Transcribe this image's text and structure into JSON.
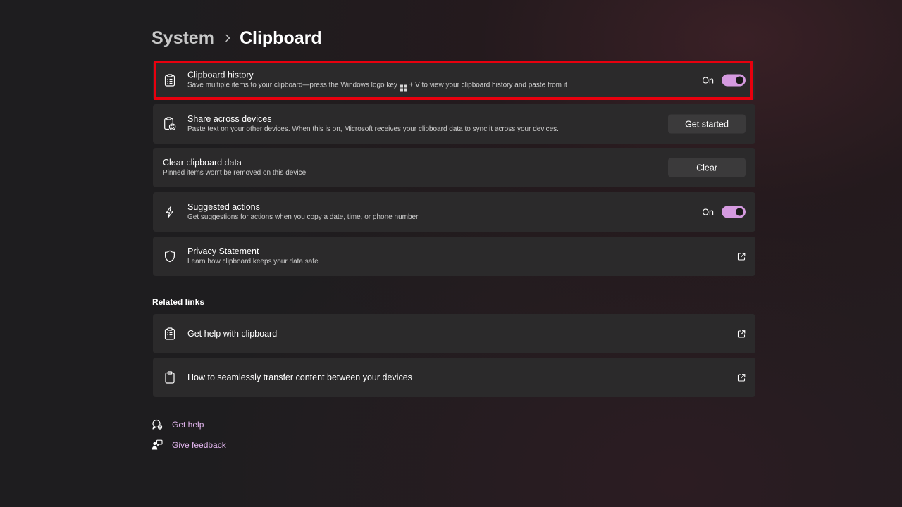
{
  "breadcrumb": {
    "parent": "System",
    "current": "Clipboard"
  },
  "settings": [
    {
      "icon": "clipboard-list-icon",
      "title": "Clipboard history",
      "description_before": "Save multiple items to your clipboard—press the Windows logo key",
      "description_after": "+ V to view your clipboard history and paste from it",
      "control": "toggle",
      "state_label": "On",
      "highlighted": true
    },
    {
      "icon": "clipboard-sync-icon",
      "title": "Share across devices",
      "description": "Paste text on your other devices. When this is on, Microsoft receives your clipboard data to sync it across your devices.",
      "control": "button",
      "button_label": "Get started"
    },
    {
      "title": "Clear clipboard data",
      "description": "Pinned items won't be removed on this device",
      "control": "button",
      "button_label": "Clear"
    },
    {
      "icon": "lightning-icon",
      "title": "Suggested actions",
      "description": "Get suggestions for actions when you copy a date, time, or phone number",
      "control": "toggle",
      "state_label": "On"
    },
    {
      "icon": "shield-icon",
      "title": "Privacy Statement",
      "description": "Learn how clipboard keeps your data safe",
      "control": "external-link"
    }
  ],
  "related_links": {
    "heading": "Related links",
    "items": [
      {
        "icon": "clipboard-list-icon",
        "label": "Get help with clipboard"
      },
      {
        "icon": "clipboard-icon",
        "label": "How to seamlessly transfer content between your devices"
      }
    ]
  },
  "footer": {
    "get_help": "Get help",
    "give_feedback": "Give feedback"
  },
  "colors": {
    "accent": "#d59ae0",
    "link": "#e3b6ef",
    "highlight_border": "#e8000e",
    "card_background": "#2b2a2b"
  }
}
